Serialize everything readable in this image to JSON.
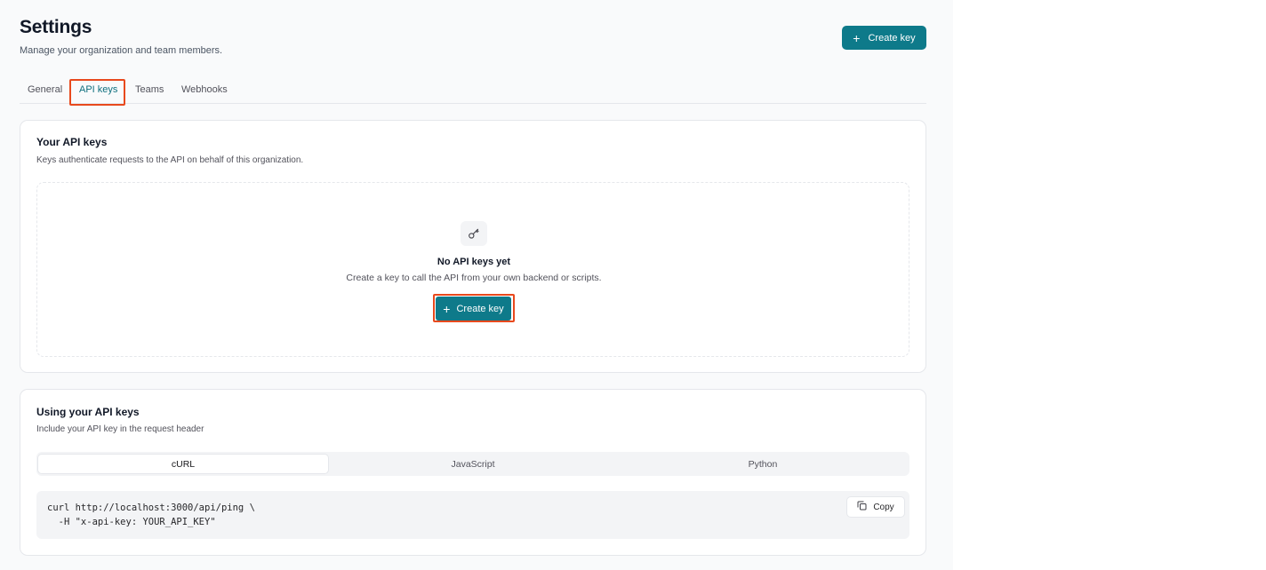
{
  "header": {
    "title": "Settings",
    "subtitle": "Manage your organization and team members.",
    "create_key_label": "Create key"
  },
  "tabs": [
    {
      "label": "General"
    },
    {
      "label": "API keys",
      "active": true
    },
    {
      "label": "Teams"
    },
    {
      "label": "Webhooks"
    }
  ],
  "api_keys_card": {
    "title": "Your API keys",
    "subtitle": "Keys authenticate requests to the API on behalf of this organization.",
    "empty_state": {
      "icon": "key-icon",
      "title": "No API keys yet",
      "description": "Create a key to call the API from your own backend or scripts.",
      "button_label": "Create key"
    }
  },
  "usage_card": {
    "title": "Using your API keys",
    "subtitle": "Include your API key in the request header",
    "languages": [
      {
        "label": "cURL",
        "active": true
      },
      {
        "label": "JavaScript"
      },
      {
        "label": "Python"
      }
    ],
    "code": [
      "curl http://localhost:3000/api/ping \\",
      "  -H \"x-api-key: YOUR_API_KEY\""
    ],
    "copy_label": "Copy"
  },
  "colors": {
    "accent": "#0e7a8a",
    "highlight": "#e8491d"
  }
}
